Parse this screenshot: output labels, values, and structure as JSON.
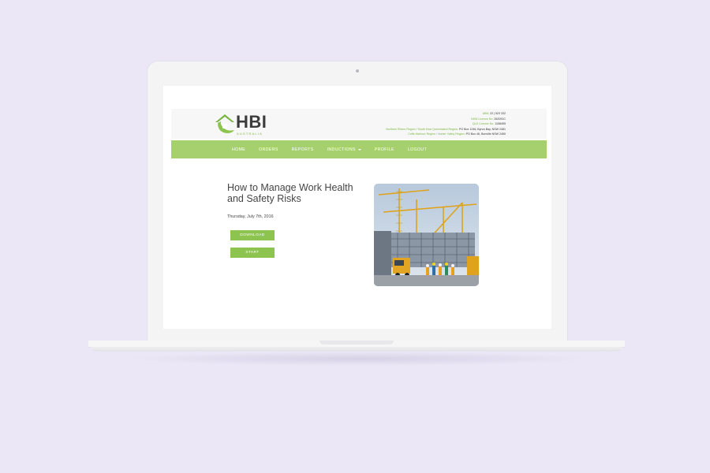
{
  "brand": {
    "name": "HBI",
    "sub": "AUSTRALIA",
    "accent": "#a6d06e",
    "button_color": "#8cc44f"
  },
  "contact": {
    "lines": [
      {
        "label": "ABN:",
        "value": "22 | 523 332"
      },
      {
        "label": "NSW Licence No:",
        "value": "262091C"
      },
      {
        "label": "QLD Licence No:",
        "value": "1158455"
      },
      {
        "label": "Northern Rivers Region / South East Queensland Region:",
        "value": "PO Box 1246, Byron Bay, NSW 2481"
      },
      {
        "label": "Coffs Harbour Region / Hunter Valley Region:",
        "value": "PO Box 46, Bonville NSW 2450"
      }
    ]
  },
  "nav": {
    "items": [
      "HOME",
      "ORDERS",
      "REPORTS",
      "INDUCTIONS",
      "PROFILE",
      "LOGOUT"
    ]
  },
  "main": {
    "title": "How to Manage Work Health and Safety Risks",
    "date": "Thursday, July 7th, 2016",
    "download_label": "DOWNLOAD",
    "start_label": "START"
  },
  "icons": [
    "house-logo-icon",
    "dropdown-caret-icon",
    "construction-site-photo"
  ]
}
